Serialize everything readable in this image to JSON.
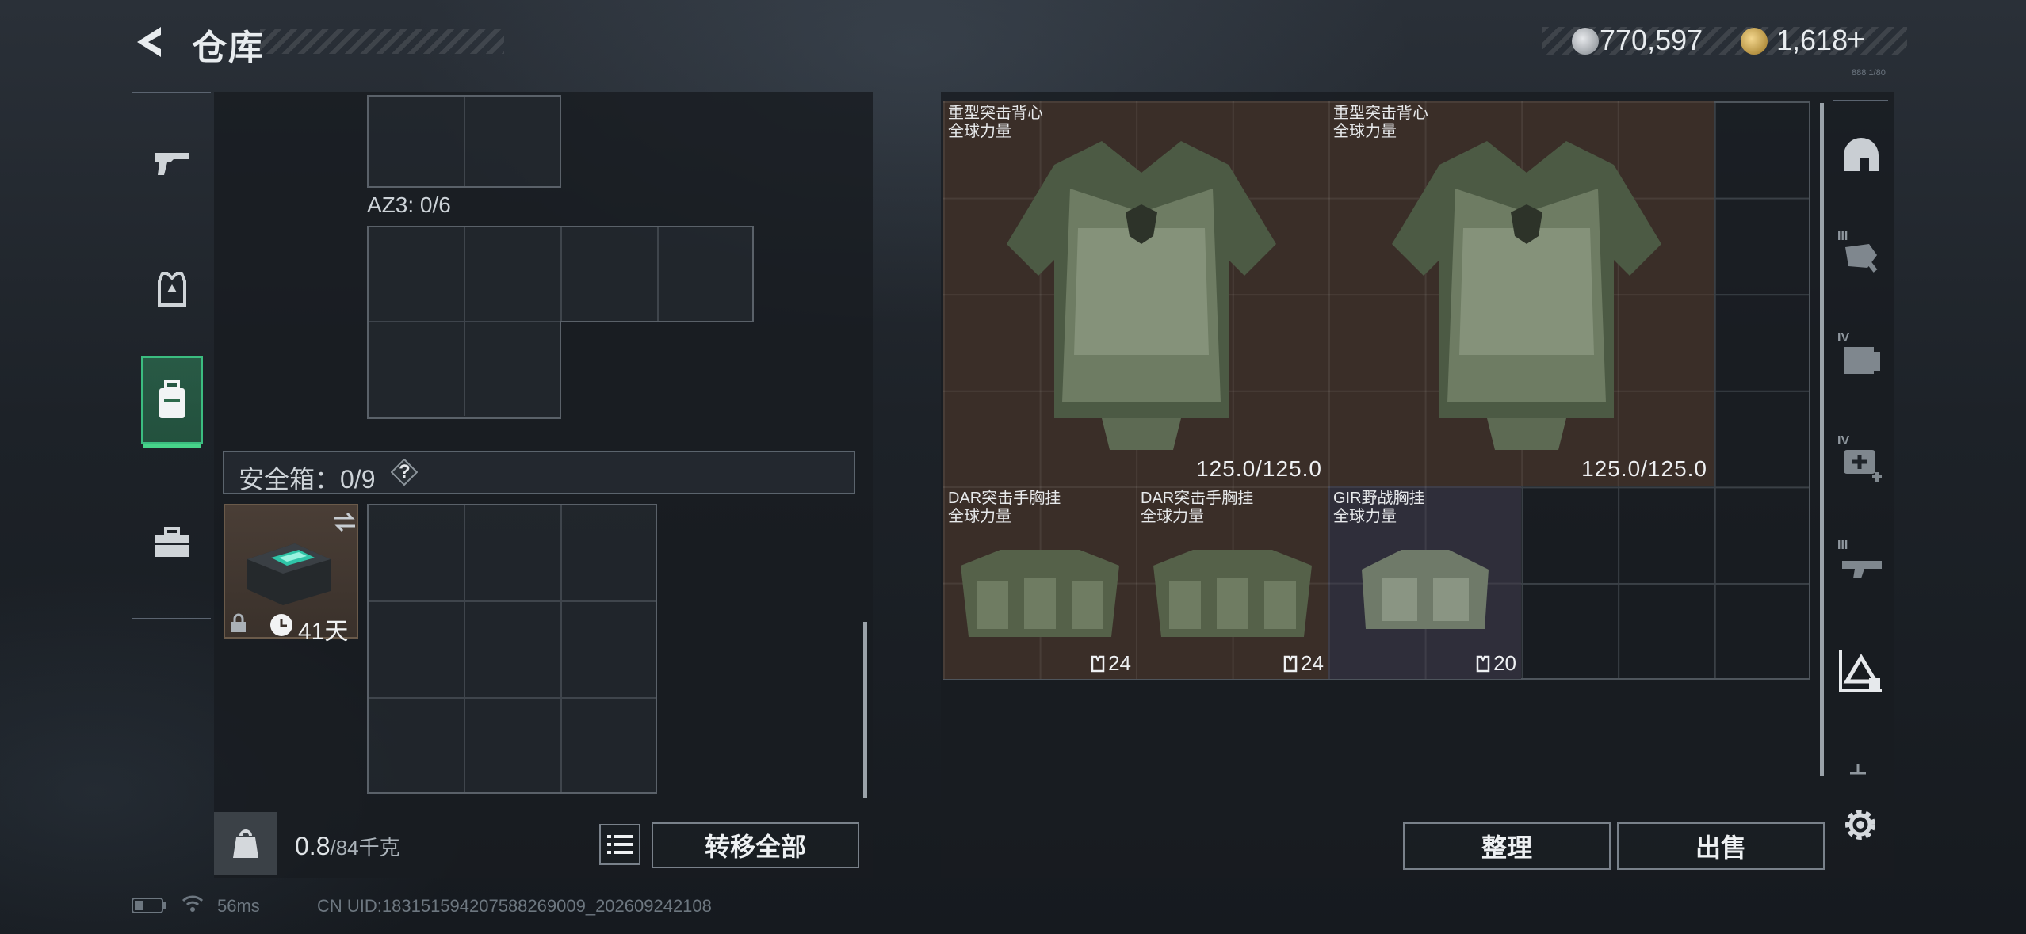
{
  "header": {
    "title": "仓库",
    "currency_silver": "770,597",
    "currency_gold": "1,618",
    "plus": "+"
  },
  "categories": [
    {
      "icon": "pistol-icon",
      "active": false
    },
    {
      "icon": "armor-rig-icon",
      "active": false
    },
    {
      "icon": "backpack-icon",
      "active": true
    },
    {
      "icon": "briefcase-icon",
      "active": false
    }
  ],
  "left": {
    "az3_label": "AZ3: 0/6",
    "safe_label": "安全箱：0/9",
    "help": "?",
    "safe_item_days": "41天",
    "weight_current": "0.8",
    "weight_max": "/84千克",
    "transfer_all": "转移全部"
  },
  "right": {
    "items": [
      {
        "name1": "重型突击背心",
        "name2": "全球力量",
        "value": "125.0/125.0"
      },
      {
        "name1": "重型突击背心",
        "name2": "全球力量",
        "value": "125.0/125.0"
      },
      {
        "name1": "DAR突击手胸挂",
        "name2": "全球力量",
        "count": "24"
      },
      {
        "name1": "DAR突击手胸挂",
        "name2": "全球力量",
        "count": "24"
      },
      {
        "name1": "GIR野战胸挂",
        "name2": "全球力量",
        "count": "20"
      }
    ],
    "sort_button": "整理",
    "sell_button": "出售",
    "tiny_label": "888 1/80"
  },
  "sidebar_icons": [
    "helmet-icon",
    "tier3-armor-icon",
    "tier4-rig-icon",
    "tier4-medkit-icon",
    "tier3-weapon-icon",
    "tier-warning-icon",
    "collapse-icon",
    "gear-icon"
  ],
  "sidebar_tiers": [
    "III",
    "IV",
    "IV",
    "III"
  ],
  "footer": {
    "ping": "56ms",
    "uid": "CN UID:183151594207588269009_202609242108"
  },
  "colors": {
    "accent_green": "#3bbd80",
    "item_brown": "#3a2e28",
    "item_purple": "#2f2e3a"
  }
}
